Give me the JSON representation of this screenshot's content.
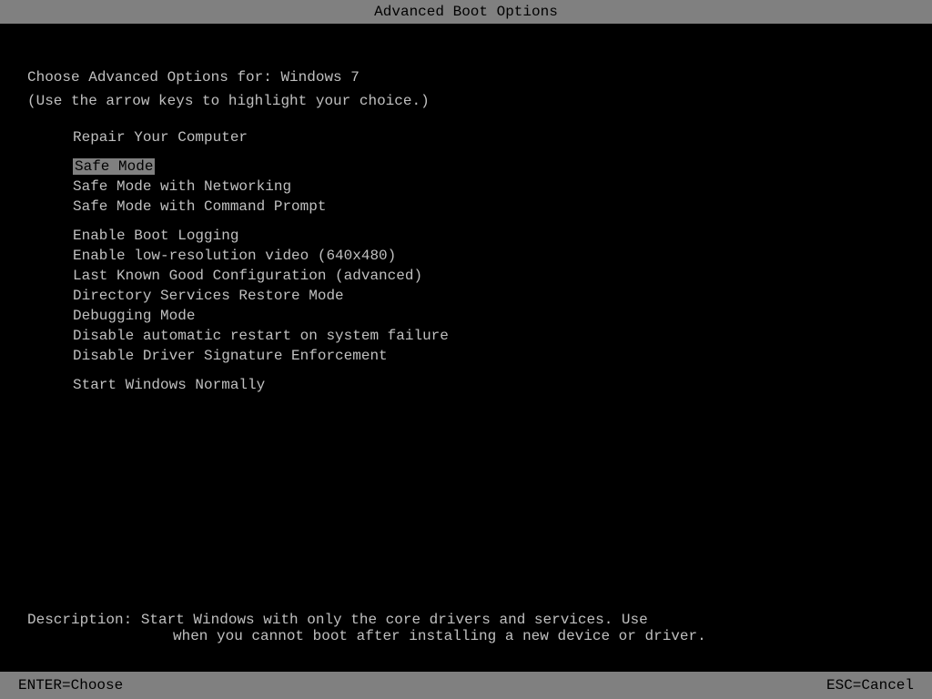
{
  "titleBar": {
    "text": "Advanced Boot Options"
  },
  "header": {
    "line1": "Choose Advanced Options for: Windows 7",
    "line2": "(Use the arrow keys to highlight your choice.)"
  },
  "menuItems": [
    {
      "id": "repair",
      "label": "Repair Your Computer",
      "selected": false,
      "group": "top"
    },
    {
      "id": "safe-mode",
      "label": "Safe Mode",
      "selected": true,
      "group": "safe"
    },
    {
      "id": "safe-mode-networking",
      "label": "Safe Mode with Networking",
      "selected": false,
      "group": "safe"
    },
    {
      "id": "safe-mode-cmd",
      "label": "Safe Mode with Command Prompt",
      "selected": false,
      "group": "safe"
    },
    {
      "id": "boot-logging",
      "label": "Enable Boot Logging",
      "selected": false,
      "group": "advanced"
    },
    {
      "id": "low-res",
      "label": "Enable low-resolution video (640x480)",
      "selected": false,
      "group": "advanced"
    },
    {
      "id": "last-known",
      "label": "Last Known Good Configuration (advanced)",
      "selected": false,
      "group": "advanced"
    },
    {
      "id": "directory",
      "label": "Directory Services Restore Mode",
      "selected": false,
      "group": "advanced"
    },
    {
      "id": "debugging",
      "label": "Debugging Mode",
      "selected": false,
      "group": "advanced"
    },
    {
      "id": "disable-restart",
      "label": "Disable automatic restart on system failure",
      "selected": false,
      "group": "advanced"
    },
    {
      "id": "disable-driver",
      "label": "Disable Driver Signature Enforcement",
      "selected": false,
      "group": "advanced"
    },
    {
      "id": "start-normally",
      "label": "Start Windows Normally",
      "selected": false,
      "group": "bottom"
    }
  ],
  "description": {
    "line1": "Description: Start Windows with only the core drivers and services. Use",
    "line2": "when you cannot boot after installing a new device or driver."
  },
  "bottomBar": {
    "enter": "ENTER=Choose",
    "esc": "ESC=Cancel"
  }
}
